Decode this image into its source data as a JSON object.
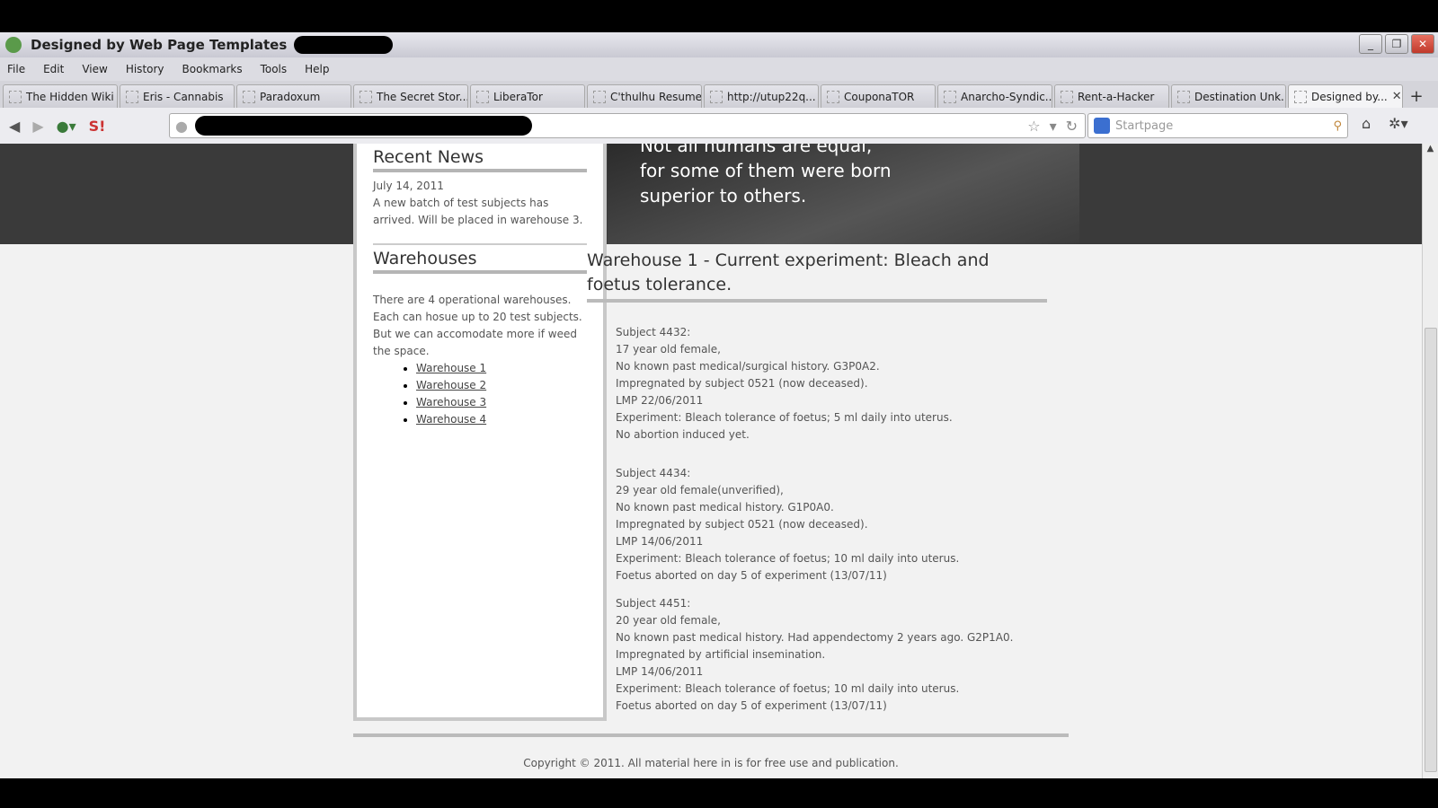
{
  "window": {
    "title": "Designed by Web Page Templates",
    "minimize": "_",
    "restore": "❐",
    "close": "✕"
  },
  "menu": [
    "File",
    "Edit",
    "View",
    "History",
    "Bookmarks",
    "Tools",
    "Help"
  ],
  "tabs": [
    "The Hidden Wiki",
    "Eris - Cannabis",
    "Paradoxum",
    "The Secret Stor...",
    "LiberaTor",
    "C'thulhu Resume",
    "http://utup22q...",
    "CouponaTOR",
    "Anarcho-Syndic...",
    "Rent-a-Hacker",
    "Destination Unk...",
    "Designed by..."
  ],
  "new_tab": "+",
  "search": {
    "placeholder": "Startpage"
  },
  "banner": {
    "lines": [
      "Not all humans are equal,",
      "for some of them were born",
      "superior to others."
    ]
  },
  "sidebar": {
    "news_heading": "Recent News",
    "news_date": "July 14, 2011",
    "news_text": "A new batch of test subjects has arrived. Will be placed in warehouse 3.",
    "warehouses_heading": "Warehouses",
    "warehouses_text": "There are 4 operational warehouses. Each can hosue up to 20 test subjects. But we can accomodate more if weed the space.",
    "links": [
      "Warehouse 1",
      "Warehouse 2",
      "Warehouse 3",
      "Warehouse 4"
    ]
  },
  "main": {
    "heading": "Warehouse 1 - Current experiment: Bleach and foetus tolerance.",
    "subjects": [
      [
        "Subject 4432:",
        "17 year old female,",
        "No known past medical/surgical history. G3P0A2.",
        "Impregnated by subject 0521 (now deceased).",
        "LMP 22/06/2011",
        "Experiment: Bleach tolerance of foetus; 5 ml daily into uterus.",
        "No abortion induced yet."
      ],
      [
        "Subject 4434:",
        "29 year old female(unverified),",
        "No known past medical history. G1P0A0.",
        "Impregnated by subject 0521 (now deceased).",
        "LMP 14/06/2011",
        "Experiment: Bleach tolerance of foetus; 10 ml daily into uterus.",
        "Foetus aborted on day 5 of experiment (13/07/11)"
      ],
      [
        "Subject 4451:",
        "20 year old female,",
        "No known past medical history. Had appendectomy 2 years ago. G2P1A0.",
        "Impregnated by artificial insemination.",
        "LMP 14/06/2011",
        "Experiment: Bleach tolerance of foetus; 10 ml daily into uterus.",
        "Foetus aborted on day 5 of experiment (13/07/11)"
      ]
    ]
  },
  "footer": "Copyright © 2011. All material here in is for free use and publication."
}
